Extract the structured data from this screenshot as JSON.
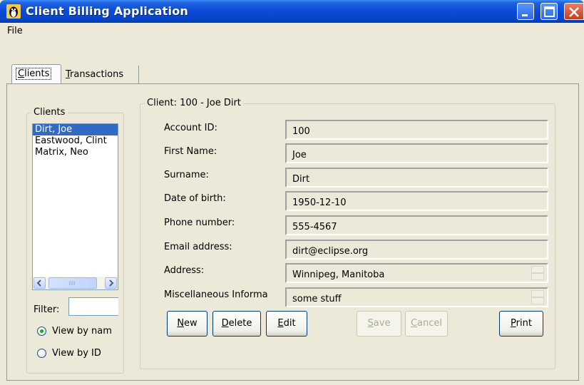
{
  "window": {
    "title": "Client Billing Application",
    "buttons": {
      "minimize": "minimize-icon",
      "maximize": "maximize-icon",
      "close": "close-icon"
    }
  },
  "menu": {
    "file": "File"
  },
  "tabs": [
    {
      "label": "Clients",
      "mnemonic": "C",
      "rest": "lients",
      "selected": true
    },
    {
      "label": "Transactions",
      "mnemonic": "T",
      "rest": "ransactions",
      "selected": false
    }
  ],
  "clients_panel": {
    "legend": "Clients",
    "items": [
      "Dirt, Joe",
      "Eastwood, Clint",
      "Matrix, Neo"
    ],
    "selected_index": 0,
    "filter_label": "Filter:",
    "filter_value": "",
    "radio_by_name": "View by nam",
    "radio_by_id": "View by ID",
    "view_mode": "by_name"
  },
  "detail": {
    "legend": "Client: 100 - Joe Dirt",
    "fields": [
      {
        "label": "Account ID:",
        "value": "100"
      },
      {
        "label": "First Name:",
        "value": "Joe"
      },
      {
        "label": "Surname:",
        "value": "Dirt"
      },
      {
        "label": "Date of birth:",
        "value": "1950-12-10"
      },
      {
        "label": "Phone number:",
        "value": "555-4567"
      },
      {
        "label": "Email address:",
        "value": "dirt@eclipse.org"
      },
      {
        "label": "Address:",
        "value": "Winnipeg, Manitoba"
      },
      {
        "label": "Miscellaneous Informa",
        "value": "some stuff"
      }
    ]
  },
  "buttons": {
    "new": {
      "m": "N",
      "r": "ew"
    },
    "delete": {
      "m": "D",
      "r": "elete"
    },
    "edit": {
      "m": "E",
      "r": "dit"
    },
    "save": {
      "m": "S",
      "r": "ave"
    },
    "cancel": {
      "m": "C",
      "r": "ancel"
    },
    "print": {
      "m": "P",
      "r": "rint"
    }
  },
  "colors": {
    "titlebar": "#0a4ad6",
    "selection": "#316ac5",
    "face": "#ece9d8"
  }
}
